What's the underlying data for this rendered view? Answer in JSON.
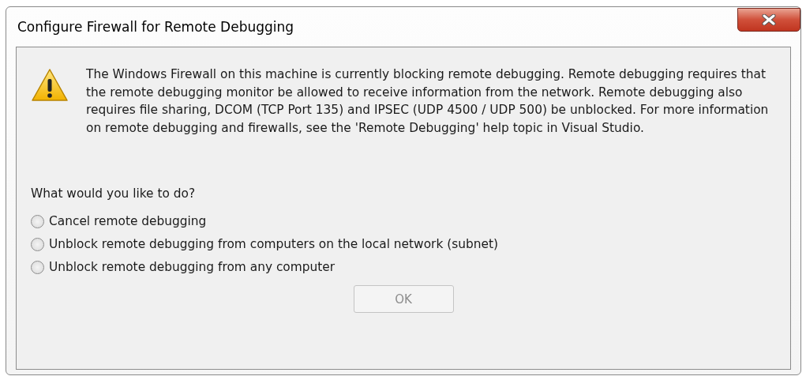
{
  "window": {
    "title": "Configure Firewall for Remote Debugging"
  },
  "message": "The Windows Firewall on this machine is currently blocking remote debugging. Remote debugging requires that the remote debugging monitor be allowed to receive information from the network. Remote debugging also requires file sharing, DCOM (TCP Port 135) and IPSEC (UDP 4500 / UDP 500) be unblocked. For more information on remote debugging and firewalls, see the 'Remote Debugging' help topic in Visual Studio.",
  "question": "What would you like to do?",
  "options": [
    {
      "label": "Cancel remote debugging",
      "selected": false
    },
    {
      "label": "Unblock remote debugging from computers on the local network (subnet)",
      "selected": false
    },
    {
      "label": "Unblock remote debugging from any computer",
      "selected": false
    }
  ],
  "ok_button": {
    "label": "OK",
    "disabled": true
  }
}
